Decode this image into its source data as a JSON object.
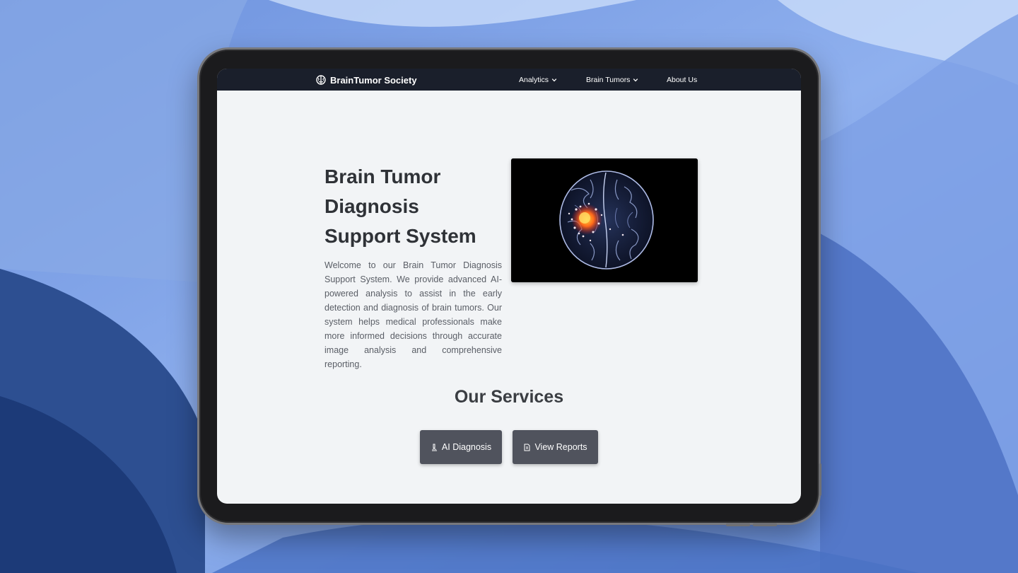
{
  "colors": {
    "navbar_bg": "#1a1f2b",
    "page_bg": "#f2f4f6",
    "button_bg": "#50535d",
    "heading_text": "#2f3237",
    "body_text": "#5a5e66"
  },
  "navbar": {
    "brand_icon": "brain-icon",
    "brand_name": "BrainTumor Society",
    "items": [
      {
        "label": "Analytics",
        "icon": "chevron-down-icon"
      },
      {
        "label": "Brain Tumors",
        "icon": "chevron-down-icon"
      },
      {
        "label": "About Us"
      }
    ]
  },
  "hero": {
    "title_lines": [
      "Brain Tumor",
      "Diagnosis",
      "Support System"
    ],
    "description": "Welcome to our Brain Tumor Diagnosis Support System. We provide advanced AI-powered analysis to assist in the early detection and diagnosis of brain tumors. Our system helps medical professionals make more informed decisions through accurate image analysis and comprehensive reporting."
  },
  "services": {
    "title": "Our Services",
    "buttons": [
      {
        "label": "AI Diagnosis",
        "icon": "microscope-icon"
      },
      {
        "label": "View Reports",
        "icon": "document-icon"
      }
    ]
  }
}
